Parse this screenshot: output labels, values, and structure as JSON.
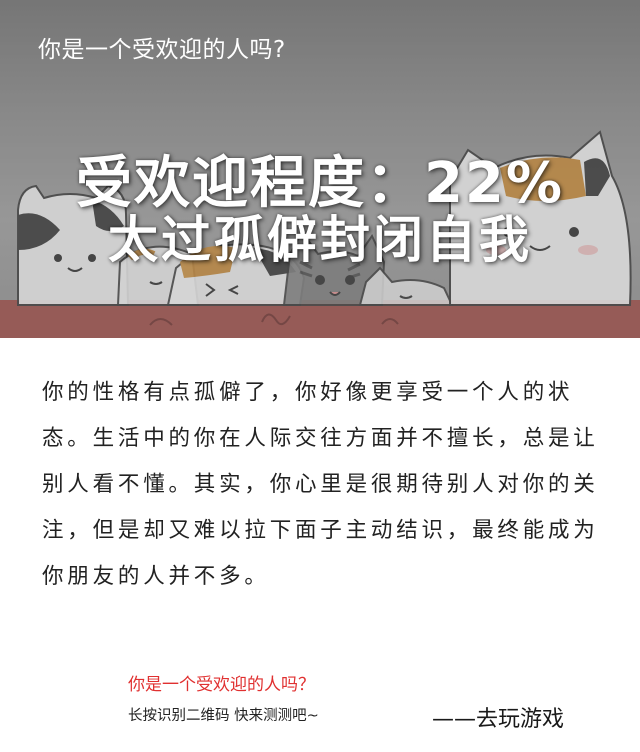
{
  "banner": {
    "title": "你是一个受欢迎的人吗?",
    "score_line": "受欢迎程度：22%",
    "verdict_line": "太过孤僻封闭自我",
    "illustration": "cats-illustration"
  },
  "description": {
    "text": "你的性格有点孤僻了，你好像更享受一个人的状态。生活中的你在人际交往方面并不擅长，总是让别人看不懂。其实，你心里是很期待别人对你的关注，但是却又难以拉下面子主动结识，最终能成为你朋友的人并不多。"
  },
  "footer": {
    "question": "你是一个受欢迎的人吗？",
    "hint": "长按识别二维码   快来测测吧~",
    "signature": "——去玩游戏"
  },
  "colors": {
    "banner_gray": "#8a8a8a",
    "banner_bottom_red": "#9c4a44",
    "question_red": "#e03030",
    "text_dark": "#222222"
  }
}
